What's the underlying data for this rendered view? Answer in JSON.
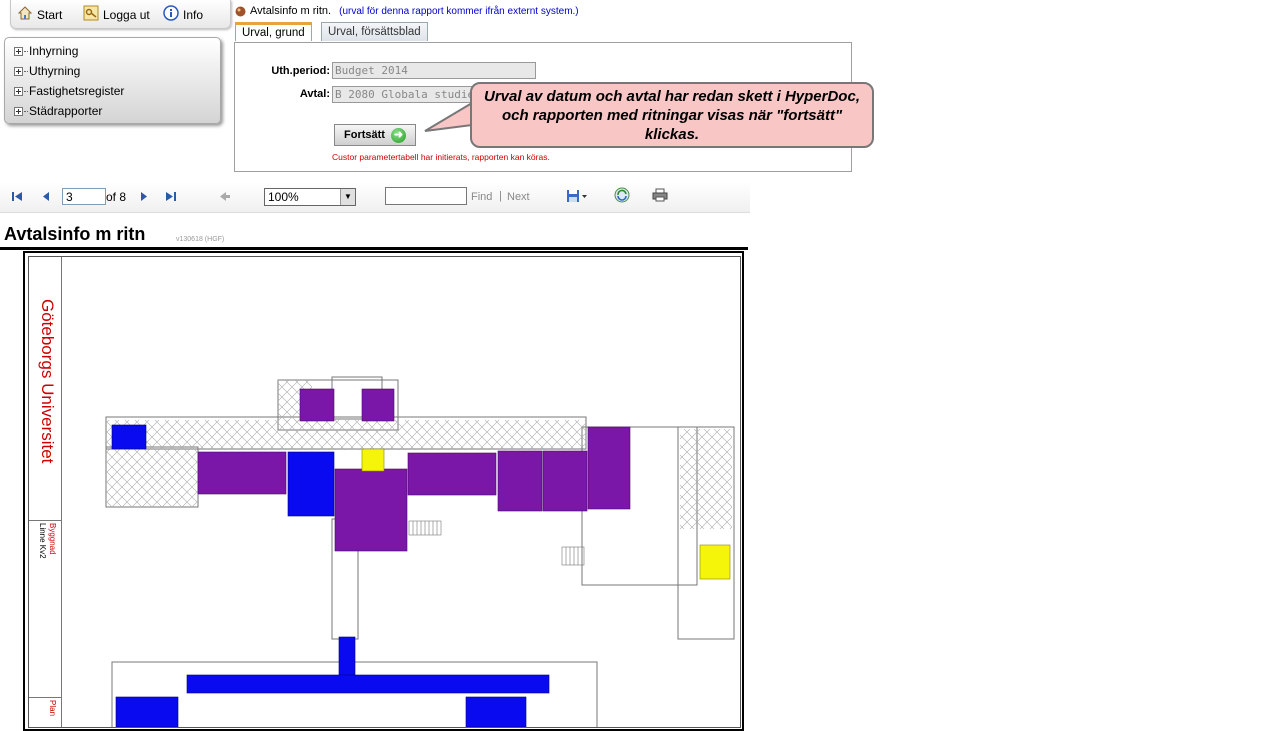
{
  "nav": {
    "start": "Start",
    "logout": "Logga ut",
    "info": "Info"
  },
  "menu": {
    "items": [
      "Inhyrning",
      "Uthyrning",
      "Fastighetsregister",
      "Städrapporter"
    ]
  },
  "report_title": {
    "name": "Avtalsinfo m ritn.",
    "note": "(urval för denna rapport kommer ifrån externt system.)"
  },
  "tabs": [
    "Urval, grund",
    "Urval, försättsblad"
  ],
  "params": {
    "period_label": "Uth.period:",
    "period_value": "Budget 2014",
    "avtal_label": "Avtal:",
    "avtal_value": "B 2080 Globala studier",
    "continue_label": "Fortsätt",
    "status_msg": "Custor parametertabell har initierats, rapporten kan köras."
  },
  "callout": {
    "text": "Urval av datum och avtal har redan skett i HyperDoc, och rapporten med ritningar visas när \"fortsätt\" klickas."
  },
  "toolbar": {
    "page_current": "3",
    "page_total": "of 8",
    "zoom": "100%",
    "find_label": "Find",
    "separator": "|",
    "next_label": "Next"
  },
  "report": {
    "header": "Avtalsinfo m ritn",
    "stamp": "v130618 (HGF)",
    "org": "Göteborgs Universitet",
    "byggnad_label": "Byggnad",
    "byggnad_value": "Linne Kv2",
    "plan_label": "Plan"
  },
  "colors": {
    "purple": "#7a16a8",
    "blue": "#0a0af0",
    "yellow": "#f5f50a",
    "callout_bg": "#f9c6c6",
    "org_red": "#cc0000"
  }
}
